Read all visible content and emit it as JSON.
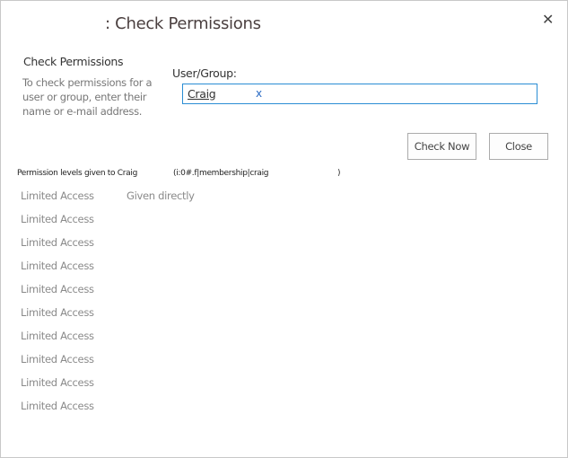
{
  "dialog": {
    "title": ": Check Permissions",
    "close_icon": "close-icon"
  },
  "section": {
    "heading": "Check Permissions",
    "description": "To check permissions for a user or group, enter their name or e-mail address."
  },
  "user_group": {
    "label": "User/Group:",
    "value": "Craig",
    "remove": "x"
  },
  "buttons": {
    "check_now": "Check Now",
    "close": "Close"
  },
  "results": {
    "header": "Permission levels given to Craig",
    "account": "(i:0#.f|membership|craig",
    "account_end": ")",
    "rows": [
      {
        "level": "Limited Access",
        "source": "Given directly"
      },
      {
        "level": "Limited Access",
        "source": ""
      },
      {
        "level": "Limited Access",
        "source": ""
      },
      {
        "level": "Limited Access",
        "source": ""
      },
      {
        "level": "Limited Access",
        "source": ""
      },
      {
        "level": "Limited Access",
        "source": ""
      },
      {
        "level": "Limited Access",
        "source": ""
      },
      {
        "level": "Limited Access",
        "source": ""
      },
      {
        "level": "Limited Access",
        "source": ""
      },
      {
        "level": "Limited Access",
        "source": ""
      }
    ]
  }
}
